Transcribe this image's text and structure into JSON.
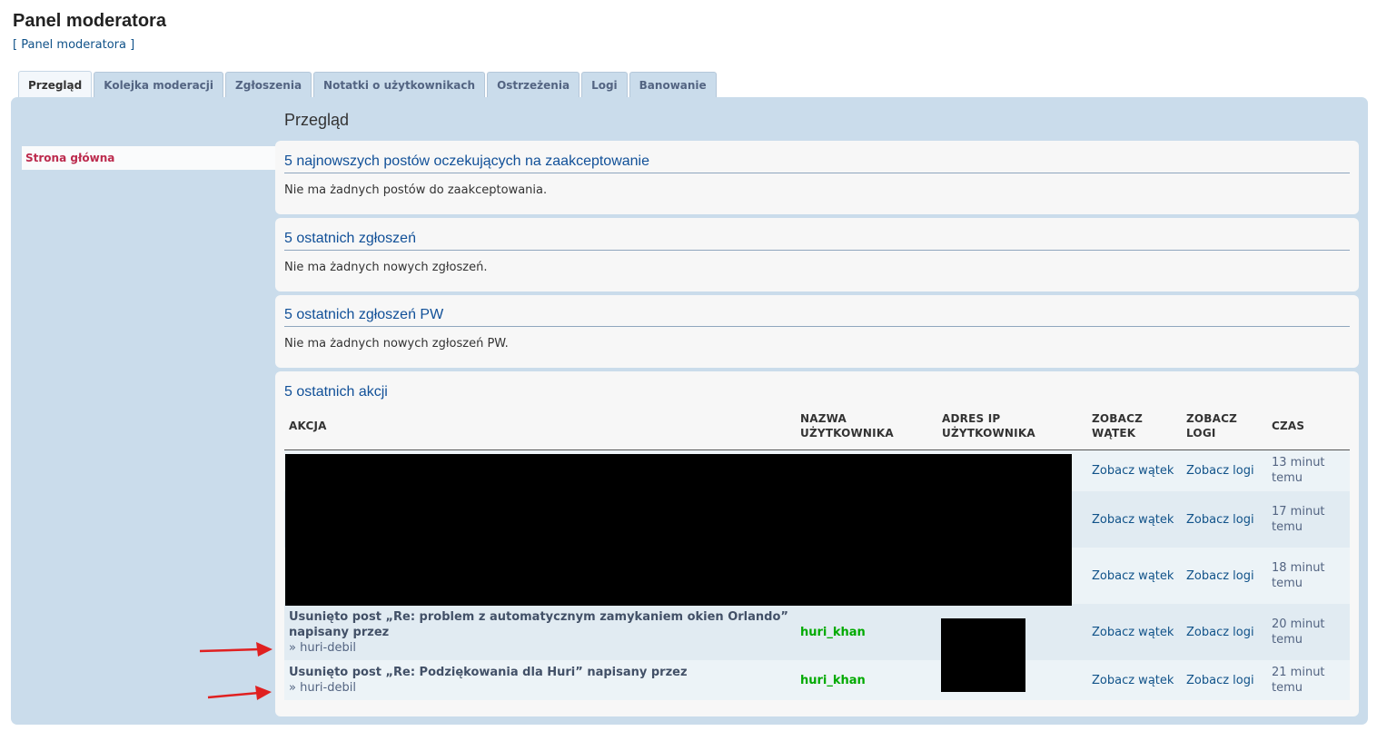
{
  "page": {
    "title": "Panel moderatora",
    "breadcrumb_open": "[ ",
    "breadcrumb_link": "Panel moderatora",
    "breadcrumb_close": " ]"
  },
  "tabs": [
    {
      "label": "Przegląd",
      "active": true
    },
    {
      "label": "Kolejka moderacji"
    },
    {
      "label": "Zgłoszenia"
    },
    {
      "label": "Notatki o użytkownikach"
    },
    {
      "label": "Ostrzeżenia"
    },
    {
      "label": "Logi"
    },
    {
      "label": "Banowanie"
    }
  ],
  "sidebar": {
    "items": [
      {
        "label": "Strona główna",
        "active": true
      }
    ]
  },
  "main": {
    "title": "Przegląd",
    "sections": [
      {
        "heading": "5 najnowszych postów oczekujących na zaakceptowanie",
        "text": "Nie ma żadnych postów do zaakceptowania."
      },
      {
        "heading": "5 ostatnich zgłoszeń",
        "text": "Nie ma żadnych nowych zgłoszeń."
      },
      {
        "heading": "5 ostatnich zgłoszeń PW",
        "text": "Nie ma żadnych nowych zgłoszeń PW."
      },
      {
        "heading": "5 ostatnich akcji"
      }
    ],
    "actions_table": {
      "headers": [
        "AKCJA",
        "NAZWA UŻYTKOWNIKA",
        "ADRES IP UŻYTKOWNIKA",
        "ZOBACZ WĄTEK",
        "ZOBACZ LOGI",
        "CZAS"
      ],
      "rows": [
        {
          "action": "",
          "sub": "",
          "user": "",
          "view_thread": "Zobacz wątek",
          "view_logs": "Zobacz logi",
          "time": "13 minut temu"
        },
        {
          "action": "",
          "sub": "",
          "user": "",
          "view_thread": "Zobacz wątek",
          "view_logs": "Zobacz logi",
          "time": "17 minut temu"
        },
        {
          "action": "",
          "sub": "",
          "user": "",
          "view_thread": "Zobacz wątek",
          "view_logs": "Zobacz logi",
          "time": "18 minut temu"
        },
        {
          "action": "Usunięto post „Re: problem z automatycznym zamykaniem okien Orlando” napisany przez",
          "sub": "» huri-debil",
          "user": "huri_khan",
          "view_thread": "Zobacz wątek",
          "view_logs": "Zobacz logi",
          "time": "20 minut temu"
        },
        {
          "action": "Usunięto post „Re: Podziękowania dla Huri” napisany przez",
          "sub": "» huri-debil",
          "user": "huri_khan",
          "view_thread": "Zobacz wątek",
          "view_logs": "Zobacz logi",
          "time": "21 minut temu"
        }
      ]
    }
  },
  "colors": {
    "accent": "#105289",
    "heading": "#115098",
    "user": "#00aa00",
    "active_nav": "#bc2a4d",
    "annotation_arrow": "#e02020"
  }
}
